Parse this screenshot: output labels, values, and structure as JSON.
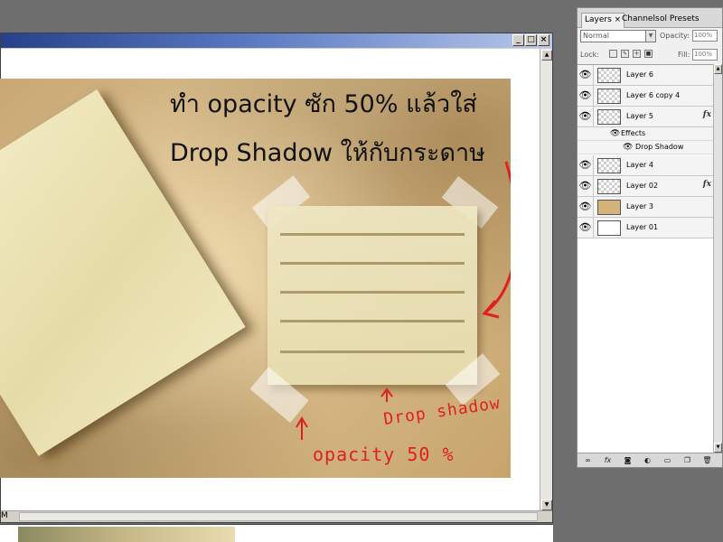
{
  "document": {
    "status_text": "M",
    "window_buttons": {
      "minimize": "_",
      "maximize": "□",
      "close": "×"
    },
    "scroll_up": "▲",
    "scroll_down": "▼"
  },
  "artwork": {
    "headline_line1": "ทำ opacity ซัก 50% แล้วใส่",
    "headline_line2": "Drop Shadow ให้กับกระดาษ",
    "annotation_drop_shadow": "Drop shadow",
    "annotation_opacity": "opacity 50 %",
    "annotation_color": "#e02020"
  },
  "layers_panel": {
    "tabs": [
      {
        "label": "Layers ×"
      },
      {
        "label": "Channels"
      },
      {
        "label": "ol Presets"
      }
    ],
    "blend_mode": "Normal",
    "opacity_label": "Opacity:",
    "opacity_value": "100%",
    "lock_label": "Lock:",
    "fill_label": "Fill:",
    "fill_value": "100%",
    "layers": [
      {
        "name": "Layer 6",
        "thumb": "checker",
        "fx": ""
      },
      {
        "name": "Layer 6 copy 4",
        "thumb": "checker",
        "fx": ""
      },
      {
        "name": "Layer 5",
        "thumb": "checker",
        "fx": "fx"
      },
      {
        "name": "Layer 4",
        "thumb": "checker",
        "fx": ""
      },
      {
        "name": "Layer 02",
        "thumb": "checker",
        "fx": "fx"
      },
      {
        "name": "Layer 3",
        "thumb": "paper",
        "fx": ""
      },
      {
        "name": "Layer 01",
        "thumb": "white",
        "fx": ""
      }
    ],
    "effects_label": "Effects",
    "drop_shadow_label": "Drop Shadow",
    "footer_icons": [
      "link-icon",
      "fx-icon",
      "mask-icon",
      "adjustment-icon",
      "group-folder-icon",
      "new-layer-icon",
      "trash-icon"
    ]
  }
}
